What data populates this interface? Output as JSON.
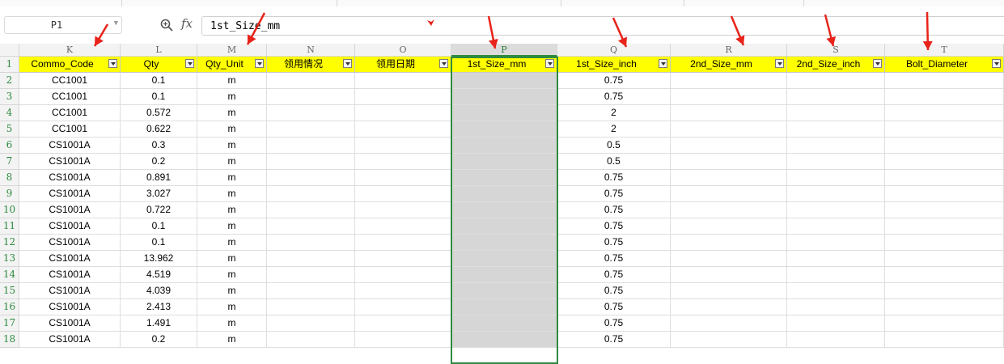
{
  "formula_bar": {
    "name_box": "P1",
    "fx_label": "fx",
    "formula": "1st_Size_mm"
  },
  "columns": [
    {
      "letter": "K",
      "header": "Commo_Code"
    },
    {
      "letter": "L",
      "header": "Qty"
    },
    {
      "letter": "M",
      "header": "Qty_Unit"
    },
    {
      "letter": "N",
      "header": "领用情况"
    },
    {
      "letter": "O",
      "header": "领用日期"
    },
    {
      "letter": "P",
      "header": "1st_Size_mm"
    },
    {
      "letter": "Q",
      "header": "1st_Size_inch"
    },
    {
      "letter": "R",
      "header": "2nd_Size_mm"
    },
    {
      "letter": "S",
      "header": "2nd_Size_inch"
    },
    {
      "letter": "T",
      "header": "Bolt_Diameter"
    }
  ],
  "row_numbers": [
    "1",
    "2",
    "3",
    "4",
    "5",
    "6",
    "7",
    "8",
    "9",
    "10",
    "11",
    "12",
    "13",
    "14",
    "15",
    "16",
    "17",
    "18"
  ],
  "rows": [
    [
      "CC1001",
      "0.1",
      "m",
      "",
      "",
      "",
      "0.75",
      "",
      "",
      ""
    ],
    [
      "CC1001",
      "0.1",
      "m",
      "",
      "",
      "",
      "0.75",
      "",
      "",
      ""
    ],
    [
      "CC1001",
      "0.572",
      "m",
      "",
      "",
      "",
      "2",
      "",
      "",
      ""
    ],
    [
      "CC1001",
      "0.622",
      "m",
      "",
      "",
      "",
      "2",
      "",
      "",
      ""
    ],
    [
      "CS1001A",
      "0.3",
      "m",
      "",
      "",
      "",
      "0.5",
      "",
      "",
      ""
    ],
    [
      "CS1001A",
      "0.2",
      "m",
      "",
      "",
      "",
      "0.5",
      "",
      "",
      ""
    ],
    [
      "CS1001A",
      "0.891",
      "m",
      "",
      "",
      "",
      "0.75",
      "",
      "",
      ""
    ],
    [
      "CS1001A",
      "3.027",
      "m",
      "",
      "",
      "",
      "0.75",
      "",
      "",
      ""
    ],
    [
      "CS1001A",
      "0.722",
      "m",
      "",
      "",
      "",
      "0.75",
      "",
      "",
      ""
    ],
    [
      "CS1001A",
      "0.1",
      "m",
      "",
      "",
      "",
      "0.75",
      "",
      "",
      ""
    ],
    [
      "CS1001A",
      "0.1",
      "m",
      "",
      "",
      "",
      "0.75",
      "",
      "",
      ""
    ],
    [
      "CS1001A",
      "13.962",
      "m",
      "",
      "",
      "",
      "0.75",
      "",
      "",
      ""
    ],
    [
      "CS1001A",
      "4.519",
      "m",
      "",
      "",
      "",
      "0.75",
      "",
      "",
      ""
    ],
    [
      "CS1001A",
      "4.039",
      "m",
      "",
      "",
      "",
      "0.75",
      "",
      "",
      ""
    ],
    [
      "CS1001A",
      "2.413",
      "m",
      "",
      "",
      "",
      "0.75",
      "",
      "",
      ""
    ],
    [
      "CS1001A",
      "1.491",
      "m",
      "",
      "",
      "",
      "0.75",
      "",
      "",
      ""
    ],
    [
      "CS1001A",
      "0.2",
      "m",
      "",
      "",
      "",
      "0.75",
      "",
      "",
      ""
    ]
  ],
  "selection": {
    "column": "P",
    "row": "1"
  },
  "colors": {
    "header_fill": "#ffff00",
    "selected_column_fill": "#d6d6d6",
    "selection_border": "#2e8b3e",
    "annotation_arrow": "#e8231a"
  },
  "icons": {
    "zoom": "zoom-icon",
    "function": "fx-icon",
    "filter": "filter-dropdown-icon",
    "annotation": "red-arrow-annotation"
  }
}
